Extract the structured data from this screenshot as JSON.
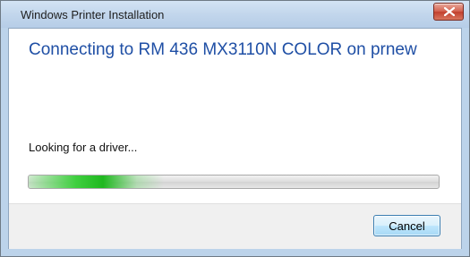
{
  "window": {
    "title": "Windows Printer Installation",
    "close_icon": "close-icon"
  },
  "main": {
    "heading": "Connecting to RM 436  MX3110N COLOR on prnew",
    "status": "Looking for a driver...",
    "progress_fraction": 0.33
  },
  "footer": {
    "cancel_label": "Cancel"
  },
  "colors": {
    "heading": "#1f4fa5",
    "progress_green": "#1fb81f",
    "close_red": "#c2402e"
  }
}
